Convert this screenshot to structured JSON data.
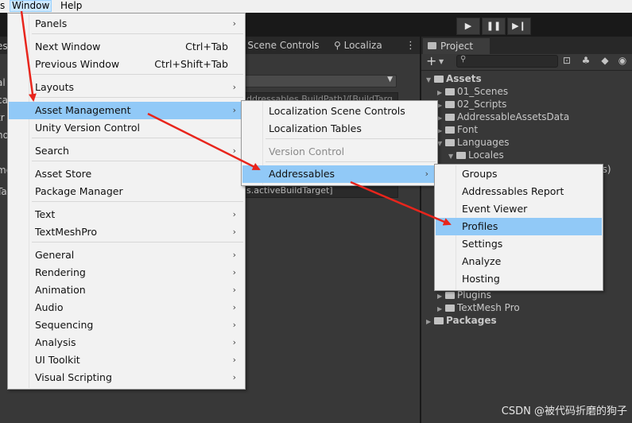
{
  "menubar": {
    "cut_left": "s",
    "window": "Window",
    "help": "Help"
  },
  "play_controls": {
    "play": "▶",
    "pause": "❚❚",
    "step": "▶❙"
  },
  "scene_tabs": {
    "scene_controls": "n Scene Controls",
    "localization": "Localiza",
    "more": "⋮",
    "field_row1": "ddressables.BuildPath]/[BuildTarg",
    "field_row2": "s.activeBuildTarget]"
  },
  "left_edge_cut": [
    "es",
    "al",
    "ca",
    "tr",
    "no",
    "me",
    "Ta"
  ],
  "project": {
    "tab_label": "Project",
    "tree": [
      {
        "label": "Assets",
        "bold": true,
        "arrow": "open",
        "indent": 0
      },
      {
        "label": "01_Scenes",
        "bold": false,
        "arrow": "closed",
        "indent": 1
      },
      {
        "label": "02_Scripts",
        "bold": false,
        "arrow": "closed",
        "indent": 1
      },
      {
        "label": "AddressableAssetsData",
        "bold": false,
        "arrow": "closed",
        "indent": 1
      },
      {
        "label": "Font",
        "bold": false,
        "arrow": "closed",
        "indent": 1
      },
      {
        "label": "Languages",
        "bold": false,
        "arrow": "open",
        "indent": 1
      },
      {
        "label": "Locales",
        "bold": false,
        "arrow": "open",
        "indent": 2
      }
    ],
    "tree_bottom": [
      {
        "label": "Plugins",
        "bold": false,
        "arrow": "closed",
        "indent": 1
      },
      {
        "label": "TextMesh Pro",
        "bold": false,
        "arrow": "closed",
        "indent": 1
      },
      {
        "label": "Packages",
        "bold": true,
        "arrow": "closed",
        "indent": 0
      }
    ],
    "right_cut": "ns)"
  },
  "window_menu": {
    "items": [
      {
        "label": "Panels",
        "submenu": true
      },
      {
        "label": "Next Window",
        "shortcut": "Ctrl+Tab"
      },
      {
        "label": "Previous Window",
        "shortcut": "Ctrl+Shift+Tab"
      },
      {
        "label": "Layouts",
        "submenu": true
      },
      {
        "label": "Asset Management",
        "submenu": true,
        "highlighted": true
      },
      {
        "label": "Unity Version Control"
      },
      {
        "label": "Search",
        "submenu": true
      },
      {
        "label": "Asset Store"
      },
      {
        "label": "Package Manager"
      },
      {
        "label": "Text",
        "submenu": true
      },
      {
        "label": "TextMeshPro",
        "submenu": true
      },
      {
        "label": "General",
        "submenu": true
      },
      {
        "label": "Rendering",
        "submenu": true
      },
      {
        "label": "Animation",
        "submenu": true
      },
      {
        "label": "Audio",
        "submenu": true
      },
      {
        "label": "Sequencing",
        "submenu": true
      },
      {
        "label": "Analysis",
        "submenu": true
      },
      {
        "label": "UI Toolkit",
        "submenu": true
      },
      {
        "label": "Visual Scripting",
        "submenu": true
      }
    ]
  },
  "asset_management_menu": {
    "items": [
      {
        "label": "Localization Scene Controls"
      },
      {
        "label": "Localization Tables"
      },
      {
        "label": "Version Control",
        "disabled": true
      },
      {
        "label": "Addressables",
        "submenu": true,
        "highlighted": true
      }
    ]
  },
  "addressables_menu": {
    "items": [
      {
        "label": "Groups"
      },
      {
        "label": "Addressables Report"
      },
      {
        "label": "Event Viewer"
      },
      {
        "label": "Profiles",
        "highlighted": true
      },
      {
        "label": "Settings"
      },
      {
        "label": "Analyze"
      },
      {
        "label": "Hosting"
      }
    ]
  },
  "submenu_arrow": "›",
  "annotation_color": "#e8251c",
  "watermark": "CSDN @被代码折磨的狗子"
}
